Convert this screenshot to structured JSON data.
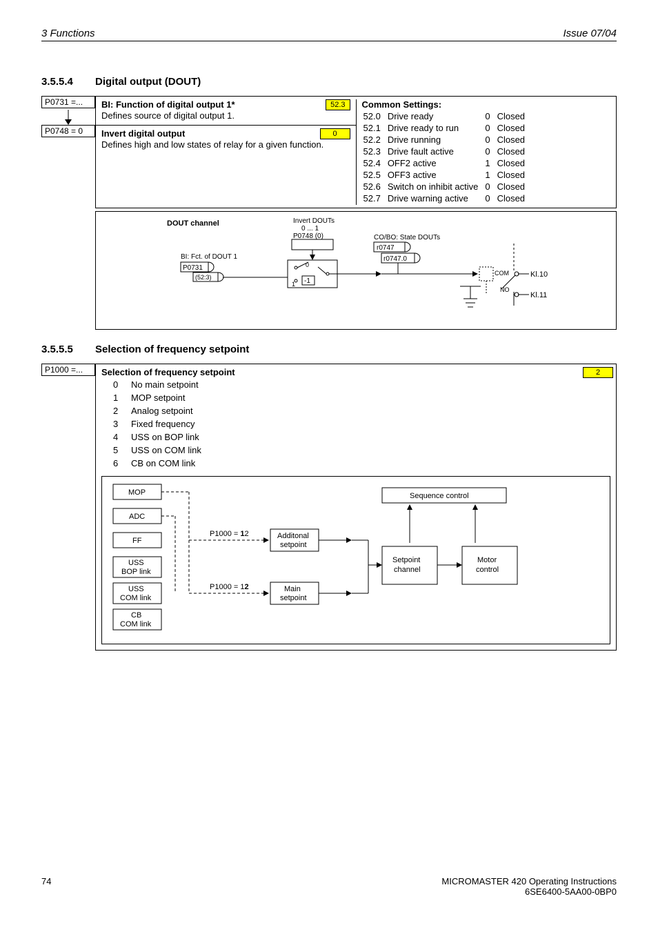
{
  "header": {
    "left": "3  Functions",
    "right": "Issue 07/04"
  },
  "s3554": {
    "num": "3.5.5.4",
    "title": "Digital output (DOUT)",
    "ref1": "P0731 =...",
    "ref2": "P0748 = 0",
    "box1": {
      "title": "BI: Function of digital output 1*",
      "desc": "Defines source of digital output 1.",
      "tag": "52.3"
    },
    "box2": {
      "title": "Invert digital output",
      "desc": "Defines high and low states of relay for a given function.",
      "tag": "0"
    },
    "common": {
      "title": "Common Settings:",
      "rows": [
        [
          "52.0",
          "Drive ready",
          "0",
          "Closed"
        ],
        [
          "52.1",
          "Drive ready to run",
          "0",
          "Closed"
        ],
        [
          "52.2",
          "Drive running",
          "0",
          "Closed"
        ],
        [
          "52.3",
          "Drive fault active",
          "0",
          "Closed"
        ],
        [
          "52.4",
          "OFF2 active",
          "1",
          "Closed"
        ],
        [
          "52.5",
          "OFF3 active",
          "1",
          "Closed"
        ],
        [
          "52.6",
          "Switch on inhibit active",
          "0",
          "Closed"
        ],
        [
          "52.7",
          "Drive warning active",
          "0",
          "Closed"
        ]
      ]
    },
    "dout": {
      "title": "DOUT channel",
      "invert": "Invert DOUTs",
      "range": "0 ... 1",
      "p0748": "P0748 (0)",
      "bifct": "BI: Fct. of DOUT 1",
      "p0731": "P0731",
      "p523": "(52:3)",
      "zero": "0",
      "minus1": "-1",
      "one": "1",
      "cobo": "CO/BO: State DOUTs",
      "r0747": "r0747",
      "r07470": "r0747.0",
      "com": "COM",
      "no": "NO",
      "kl10": "Kl.10",
      "kl11": "Kl.11"
    }
  },
  "s3555": {
    "num": "3.5.5.5",
    "title": "Selection of frequency setpoint",
    "ref": "P1000 =...",
    "tag": "2",
    "heading": "Selection of frequency setpoint",
    "opts": [
      [
        "0",
        "No main setpoint"
      ],
      [
        "1",
        "MOP setpoint"
      ],
      [
        "2",
        "Analog setpoint"
      ],
      [
        "3",
        "Fixed frequency"
      ],
      [
        "4",
        "USS on BOP link"
      ],
      [
        "5",
        "USS on COM link"
      ],
      [
        "6",
        "CB on COM link"
      ]
    ],
    "diag": {
      "mop": "MOP",
      "adc": "ADC",
      "ff": "FF",
      "ussbop": "USS\nBOP link",
      "usscom": "USS\nCOM link",
      "cbcom": "CB\nCOM link",
      "p12a": "P1000 = ",
      "p12b": "1",
      "p12c": "2",
      "p12d": "P1000 = 1",
      "p12e": "2",
      "addset": "Additonal\nsetpoint",
      "mainset": "Main\nsetpoint",
      "seq": "Sequence control",
      "setch": "Setpoint\nchannel",
      "motor": "Motor\ncontrol"
    }
  },
  "footer": {
    "pagenum": "74",
    "line1": "MICROMASTER 420    Operating Instructions",
    "line2": "6SE6400-5AA00-0BP0"
  }
}
